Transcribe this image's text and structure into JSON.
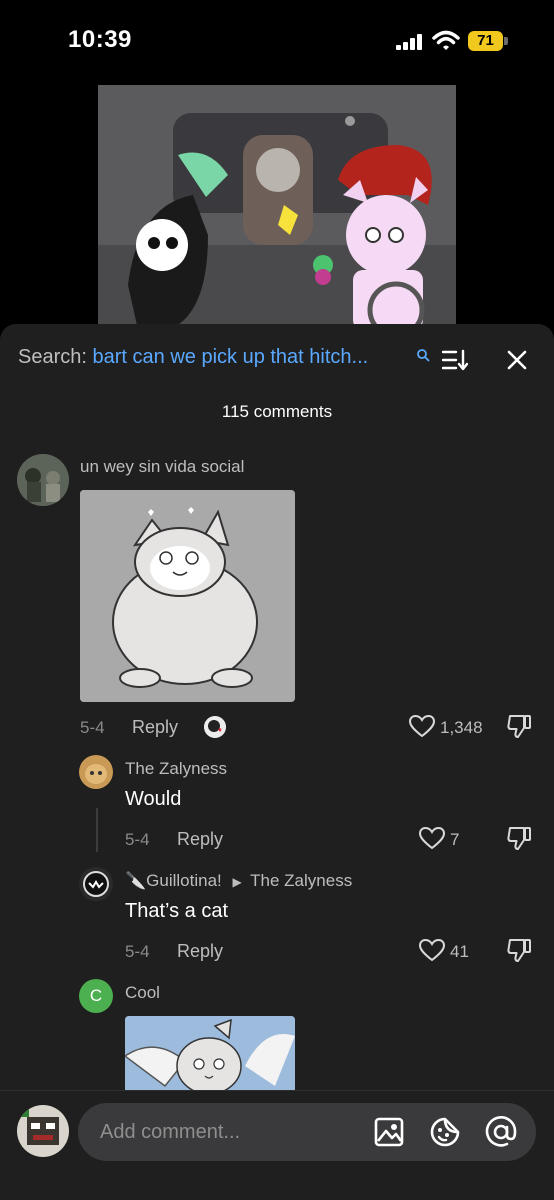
{
  "status_bar": {
    "time": "10:39",
    "battery": "71",
    "icons": [
      "cellular-signal-icon",
      "wifi-icon",
      "battery-icon"
    ]
  },
  "video": {
    "description_icon": "video-thumbnail"
  },
  "comments_panel": {
    "search_label": "Search:",
    "search_query": "bart can we pick up that hitch...",
    "count_label": "115 comments",
    "icons": [
      "search-icon",
      "sort-icon",
      "close-icon"
    ]
  },
  "comments": [
    {
      "username": "un wey sin vida social",
      "date": "5-4",
      "reply_label": "Reply",
      "likes": "1,348",
      "has_image": true
    },
    {
      "username": "The Zalyness",
      "text": "Would",
      "date": "5-4",
      "reply_label": "Reply",
      "likes": "7"
    },
    {
      "username": "🔪Guillotina!",
      "reply_to": "The Zalyness",
      "text": "That’s a cat",
      "date": "5-4",
      "reply_label": "Reply",
      "likes": "41"
    },
    {
      "username": "Cool",
      "avatar_letter": "C",
      "has_image": true
    }
  ],
  "input_bar": {
    "placeholder": "Add comment...",
    "icons": [
      "image-icon",
      "emoji-icon",
      "mention-icon"
    ]
  },
  "colors": {
    "panel_bg": "#1f1f1f",
    "accent_blue": "#5aa9ff",
    "battery_yellow": "#f0c81e",
    "avatar_green": "#4caf50"
  }
}
